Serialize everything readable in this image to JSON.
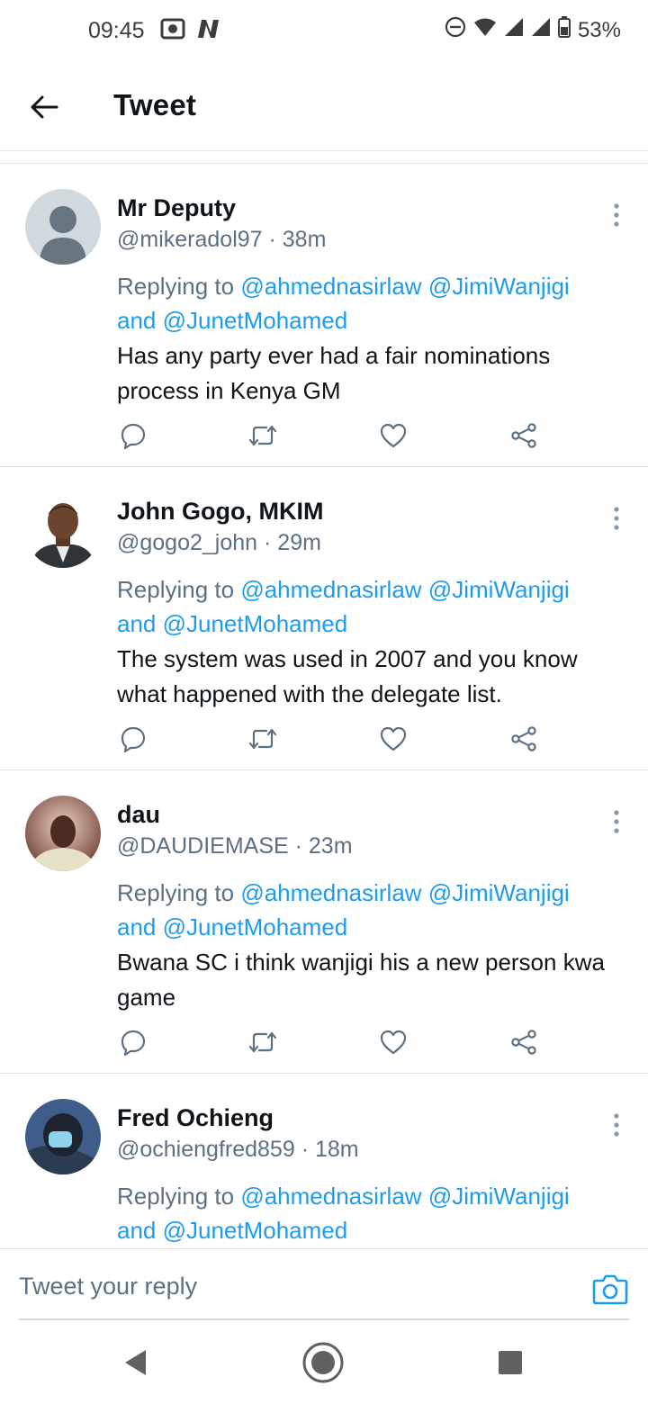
{
  "status_bar": {
    "time": "09:45",
    "battery": "53%",
    "icons": [
      "photo-icon",
      "n-app-icon",
      "dnd-icon",
      "wifi-icon",
      "signal-icon",
      "signal-icon",
      "battery-icon"
    ]
  },
  "header": {
    "title": "Tweet",
    "back_icon": "back-arrow-icon"
  },
  "tweets": [
    {
      "name": "Mr Deputy",
      "handle": "@mikeradol97 · 38m",
      "replying_prefix": "Replying to ",
      "mention1": "@ahmednasirlaw",
      "mention2": "@JimiWanjigi",
      "and": "and ",
      "mention3": "@JunetMohamed",
      "text": "Has any party ever had a fair nominations process in Kenya GM"
    },
    {
      "name": "John Gogo, MKIM",
      "handle": "@gogo2_john · 29m",
      "replying_prefix": "Replying to ",
      "mention1": "@ahmednasirlaw",
      "mention2": "@JimiWanjigi",
      "and": "and ",
      "mention3": "@JunetMohamed",
      "text": "The system was used in 2007 and you know what happened with the delegate list."
    },
    {
      "name": "dau",
      "handle": "@DAUDIEMASE · 23m",
      "replying_prefix": "Replying to ",
      "mention1": "@ahmednasirlaw",
      "mention2": "@JimiWanjigi",
      "and": "and ",
      "mention3": "@JunetMohamed",
      "text": "Bwana SC i think wanjigi his a new person kwa game"
    },
    {
      "name": "Fred Ochieng",
      "handle": "@ochiengfred859 · 18m",
      "replying_prefix": "Replying to ",
      "mention1": "@ahmednasirlaw",
      "mention2": "@JimiWanjigi",
      "and": "and ",
      "mention3": "@JunetMohamed",
      "text": ""
    }
  ],
  "reply_bar": {
    "placeholder": "Tweet your reply"
  },
  "colors": {
    "accent": "#1d9bf0",
    "secondary_text": "#5b7083",
    "primary_text": "#0f1419"
  }
}
